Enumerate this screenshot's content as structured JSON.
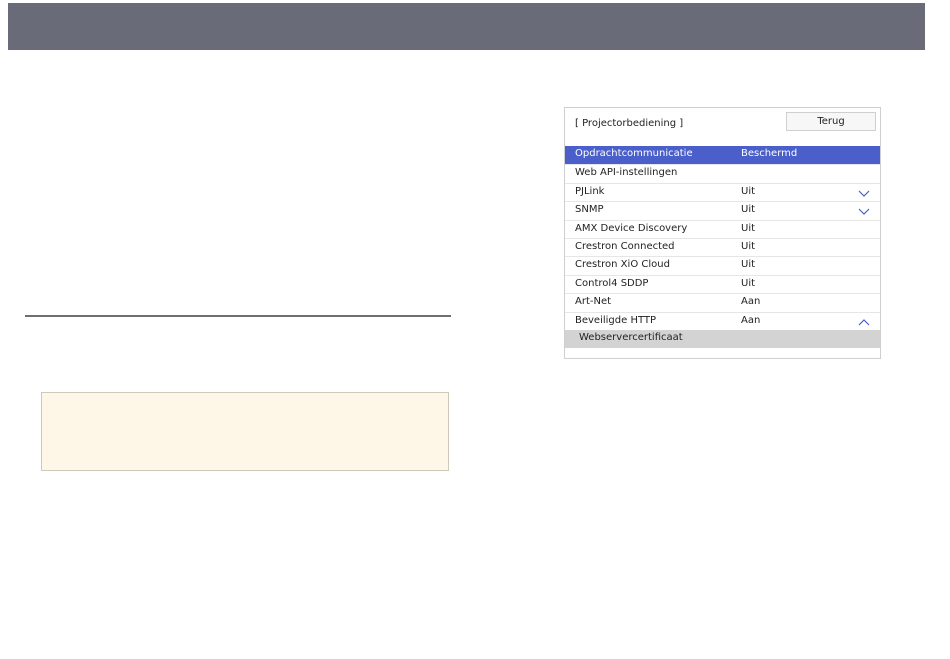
{
  "panel": {
    "title": "[ Projectorbediening ]",
    "back_label": "Terug",
    "items": [
      {
        "label": "Opdrachtcommunicatie",
        "value": "Beschermd",
        "selected": true,
        "chevron": ""
      },
      {
        "label": "Web API-instellingen",
        "value": "",
        "chevron": ""
      },
      {
        "label": "PJLink",
        "value": "Uit",
        "chevron": "down"
      },
      {
        "label": "SNMP",
        "value": "Uit",
        "chevron": "down"
      },
      {
        "label": "AMX Device Discovery",
        "value": "Uit",
        "chevron": ""
      },
      {
        "label": "Crestron Connected",
        "value": "Uit",
        "chevron": ""
      },
      {
        "label": "Crestron XiO Cloud",
        "value": "Uit",
        "chevron": ""
      },
      {
        "label": "Control4 SDDP",
        "value": "Uit",
        "chevron": ""
      },
      {
        "label": "Art-Net",
        "value": "Aan",
        "chevron": ""
      },
      {
        "label": "Beveiligde HTTP",
        "value": "Aan",
        "chevron": "up"
      },
      {
        "label": "Webservercertificaat",
        "value": "",
        "chevron": "",
        "sub": true
      }
    ]
  },
  "colors": {
    "banner": "#6a6b78",
    "selected_row": "#4a5fc9",
    "sub_row": "#d3d3d3",
    "note_box": "#fef6e6"
  }
}
